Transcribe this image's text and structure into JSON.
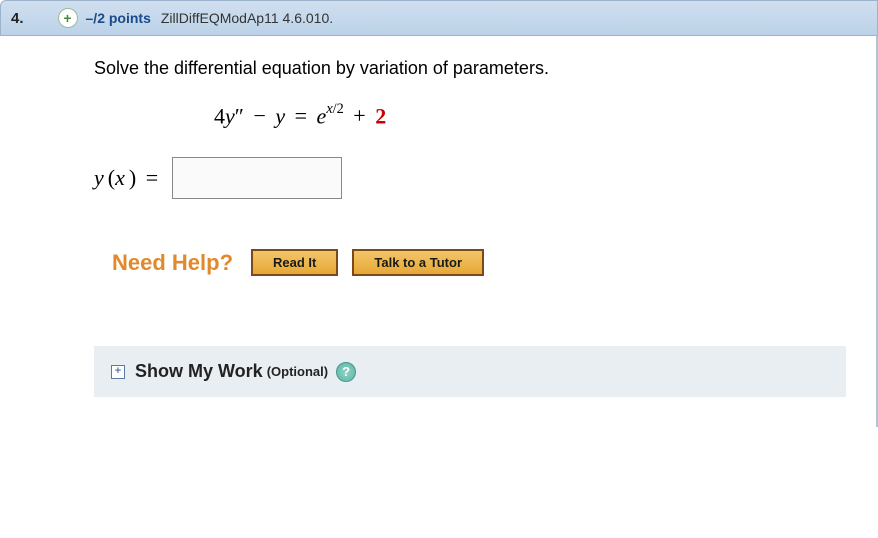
{
  "header": {
    "number": "4.",
    "points": "–/2 points",
    "reference": "ZillDiffEQModAp11 4.6.010."
  },
  "prompt": "Solve the differential equation by variation of parameters.",
  "equation": {
    "coef1": "4",
    "var1": "y",
    "prime": "″",
    "minus": "−",
    "var2": "y",
    "eq": "=",
    "base": "e",
    "exp_var": "x",
    "exp_div": "/2",
    "plus": "+",
    "last": "2"
  },
  "answer": {
    "label_y": "y",
    "label_paren_open": "(",
    "label_x": "x",
    "label_paren_close": ")",
    "eq": "="
  },
  "help": {
    "title": "Need Help?",
    "read": "Read It",
    "tutor": "Talk to a Tutor"
  },
  "show_work": {
    "title": "Show My Work",
    "optional": "(Optional)"
  }
}
